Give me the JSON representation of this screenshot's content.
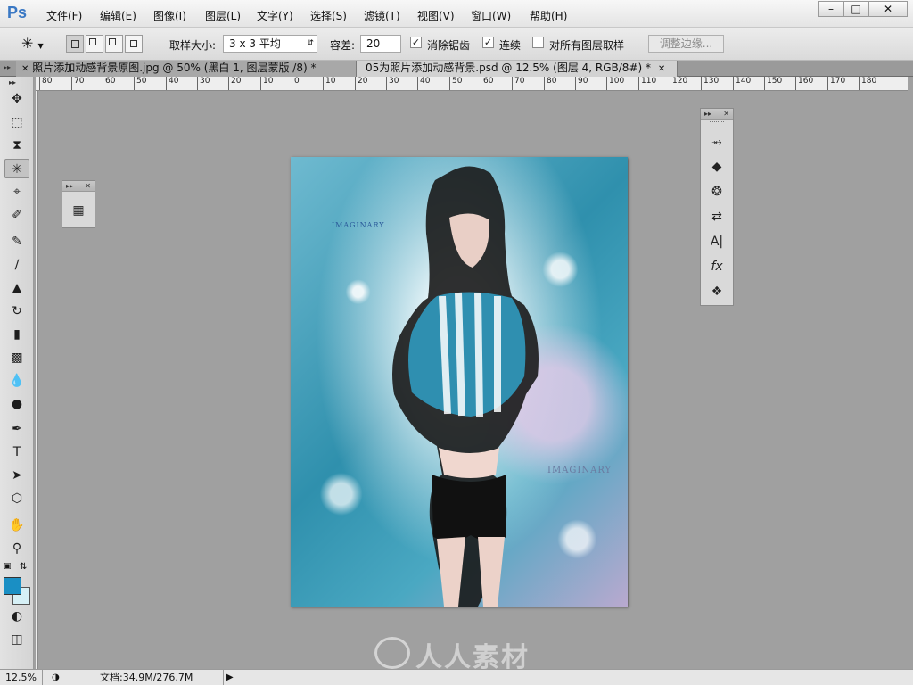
{
  "app": {
    "logo": "Ps",
    "menu": [
      "文件(F)",
      "编辑(E)",
      "图像(I)",
      "图层(L)",
      "文字(Y)",
      "选择(S)",
      "滤镜(T)",
      "视图(V)",
      "窗口(W)",
      "帮助(H)"
    ],
    "window_buttons": [
      "minimize",
      "restore",
      "close"
    ]
  },
  "options": {
    "tool_icon": "magic-wand-icon",
    "selection_modes": [
      "new-selection",
      "add-to-selection",
      "subtract-from-selection",
      "intersect-selection"
    ],
    "sample_size_label": "取样大小:",
    "sample_size_value": "3 x 3 平均",
    "tolerance_label": "容差:",
    "tolerance_value": "20",
    "antialias_label": "消除锯齿",
    "antialias_checked": true,
    "contiguous_label": "连续",
    "contiguous_checked": true,
    "sample_all_label": "对所有图层取样",
    "sample_all_checked": false,
    "refine_edge_label": "调整边缘..."
  },
  "tabs": [
    {
      "label": "照片添加动感背景原图.jpg @ 50% (黑白 1, 图层蒙版 /8) *",
      "active": false
    },
    {
      "label": "05为照片添加动感背景.psd @ 12.5% (图层 4, RGB/8#) *",
      "active": true
    }
  ],
  "ruler": {
    "h_ticks": [
      "80",
      "70",
      "60",
      "50",
      "40",
      "30",
      "20",
      "10",
      "0",
      "10",
      "20",
      "30",
      "40",
      "50",
      "60",
      "70",
      "80",
      "90",
      "100",
      "110",
      "120",
      "130",
      "140",
      "150",
      "160",
      "170",
      "180"
    ]
  },
  "tools": [
    "move-tool-icon",
    "marquee-tool-icon",
    "lasso-tool-icon",
    "magic-wand-tool-icon",
    "crop-tool-icon",
    "eyedropper-tool-icon",
    "healing-brush-icon",
    "brush-tool-icon",
    "clone-stamp-icon",
    "history-brush-icon",
    "eraser-tool-icon",
    "gradient-tool-icon",
    "blur-tool-icon",
    "dodge-tool-icon",
    "pen-tool-icon",
    "type-tool-icon",
    "path-selection-icon",
    "shape-tool-icon",
    "hand-tool-icon",
    "zoom-tool-icon"
  ],
  "colors": {
    "foreground": "#1a8fc4",
    "background": "#d6f0f6",
    "ui_gray": "#a0a0a0"
  },
  "canvas": {
    "watermark_top": "IMAGINARY",
    "watermark_bottom": "IMAGINARY"
  },
  "panels": {
    "small_panel_icons": [
      "3d-panel-icon"
    ],
    "right_panel_icons": [
      "paths-icon",
      "layers-icon",
      "channels-icon",
      "adjustments-icon",
      "character-icon",
      "styles-icon",
      "brush-presets-icon"
    ]
  },
  "status": {
    "zoom": "12.5%",
    "doc_size": "文档:34.9M/276.7M"
  },
  "site_watermark": "人人素材"
}
